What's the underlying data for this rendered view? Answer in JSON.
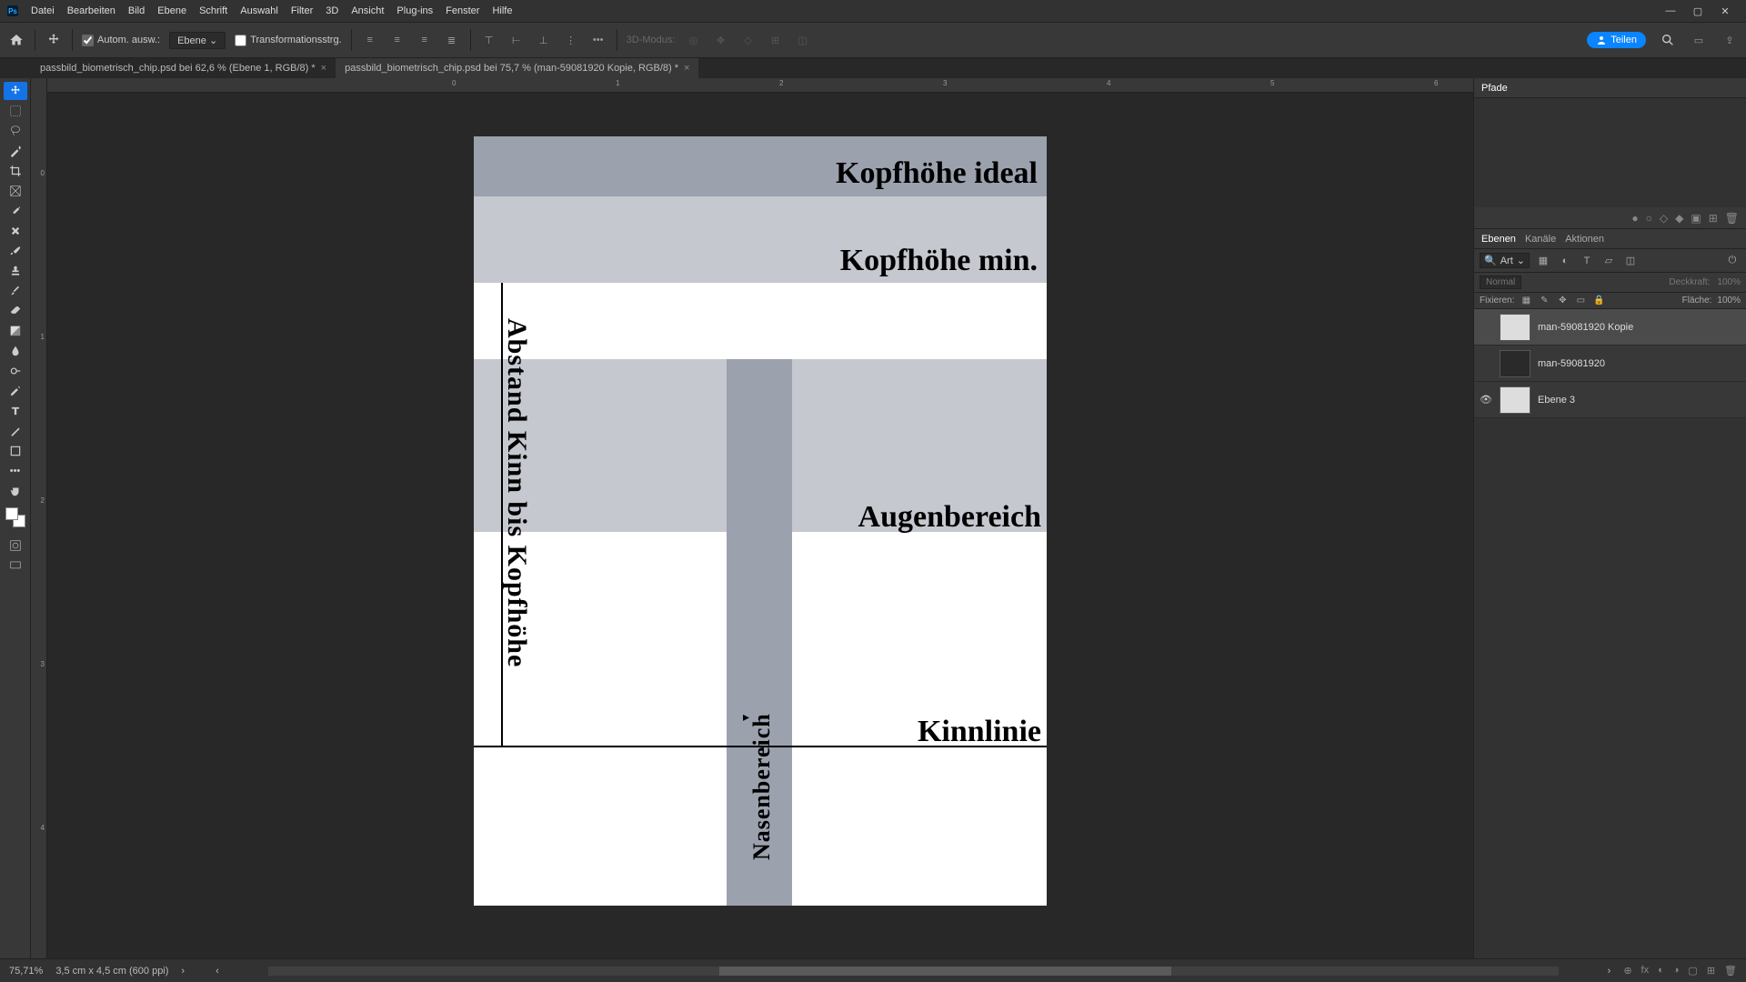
{
  "menu": {
    "items": [
      "Datei",
      "Bearbeiten",
      "Bild",
      "Ebene",
      "Schrift",
      "Auswahl",
      "Filter",
      "3D",
      "Ansicht",
      "Plug-ins",
      "Fenster",
      "Hilfe"
    ]
  },
  "optbar": {
    "auto_select_label": "Autom. ausw.:",
    "layer_label": "Ebene",
    "transform_label": "Transformationsstrg.",
    "mode3d_label": "3D-Modus:",
    "share_label": "Teilen"
  },
  "tabs": [
    {
      "label": "passbild_biometrisch_chip.psd bei 62,6 % (Ebene 1, RGB/8) *",
      "active": false
    },
    {
      "label": "passbild_biometrisch_chip.psd bei 75,7 % (man-59081920 Kopie, RGB/8) *",
      "active": true
    }
  ],
  "ruler_h": [
    {
      "pos": 445,
      "v": "0"
    },
    {
      "pos": 625,
      "v": "1"
    },
    {
      "pos": 805,
      "v": "2"
    },
    {
      "pos": 985,
      "v": "3"
    },
    {
      "pos": 1165,
      "v": "4"
    },
    {
      "pos": 1345,
      "v": "5"
    },
    {
      "pos": 1525,
      "v": "6"
    }
  ],
  "ruler_v": [
    {
      "pos": 100,
      "v": "0"
    },
    {
      "pos": 280,
      "v": "1"
    },
    {
      "pos": 460,
      "v": "2"
    },
    {
      "pos": 640,
      "v": "3"
    },
    {
      "pos": 820,
      "v": "4"
    }
  ],
  "document": {
    "labels": {
      "kopf_ideal": "Kopfhöhe ideal",
      "kopf_min": "Kopfhöhe min.",
      "augen": "Augenbereich",
      "kinn": "Kinnlinie",
      "abstand": "Abstand Kinn bis Kopfhöhe",
      "nase": "Nasenbereich"
    }
  },
  "rpanel": {
    "top_tab": "Pfade",
    "layer_tabs": [
      "Ebenen",
      "Kanäle",
      "Aktionen"
    ],
    "filter_label": "Art",
    "mode_label": "Normal",
    "opacity_label": "Deckkraft:",
    "opacity_value": "100%",
    "lock_label": "Fixieren:",
    "fill_label": "Fläche:",
    "fill_value": "100%",
    "layers": [
      {
        "name": "man-59081920 Kopie",
        "visible": false,
        "selected": true,
        "thumb": "light"
      },
      {
        "name": "man-59081920",
        "visible": false,
        "selected": false,
        "thumb": "dark"
      },
      {
        "name": "Ebene 3",
        "visible": true,
        "selected": false,
        "thumb": "light"
      }
    ]
  },
  "status": {
    "zoom": "75,71%",
    "dims": "3,5 cm x 4,5 cm (600 ppi)"
  }
}
